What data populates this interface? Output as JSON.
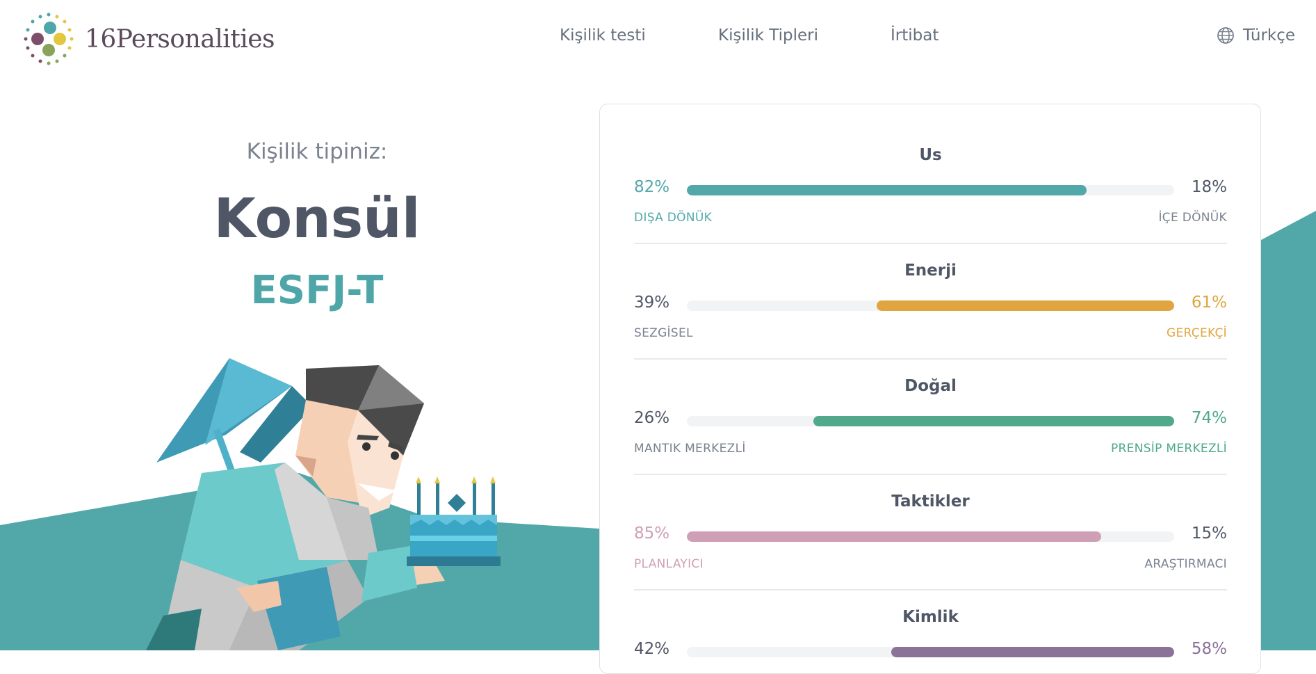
{
  "header": {
    "brand": "16Personalities",
    "nav": [
      {
        "label": "Kişilik testi"
      },
      {
        "label": "Kişilik Tipleri"
      },
      {
        "label": "İrtibat"
      }
    ],
    "language": "Türkçe"
  },
  "result": {
    "label": "Kişilik tipiniz:",
    "name": "Konsül",
    "code": "ESFJ-T"
  },
  "colors": {
    "teal": "#52a8a9",
    "yellow": "#e0a53f",
    "green": "#4fa98a",
    "pink": "#cf9fb5",
    "purple": "#8a7299",
    "dark_text": "#4f5766"
  },
  "traits": [
    {
      "title": "Us",
      "left_pct": "82%",
      "right_pct": "18%",
      "left_label": "DIŞA DÖNÜK",
      "right_label": "İÇE DÖNÜK",
      "dominant": "left",
      "fill_fraction": 0.82,
      "color": "#52a8a9"
    },
    {
      "title": "Enerji",
      "left_pct": "39%",
      "right_pct": "61%",
      "left_label": "SEZGİSEL",
      "right_label": "GERÇEKÇİ",
      "dominant": "right",
      "fill_fraction": 0.61,
      "color": "#e0a53f"
    },
    {
      "title": "Doğal",
      "left_pct": "26%",
      "right_pct": "74%",
      "left_label": "MANTIK MERKEZLİ",
      "right_label": "PRENSİP MERKEZLİ",
      "dominant": "right",
      "fill_fraction": 0.74,
      "color": "#4fa98a"
    },
    {
      "title": "Taktikler",
      "left_pct": "85%",
      "right_pct": "15%",
      "left_label": "PLANLAYICI",
      "right_label": "ARAŞTIRMACI",
      "dominant": "left",
      "fill_fraction": 0.85,
      "color": "#cf9fb5"
    },
    {
      "title": "Kimlik",
      "left_pct": "42%",
      "right_pct": "58%",
      "left_label": "",
      "right_label": "",
      "dominant": "right",
      "fill_fraction": 0.58,
      "color": "#8a7299"
    }
  ]
}
